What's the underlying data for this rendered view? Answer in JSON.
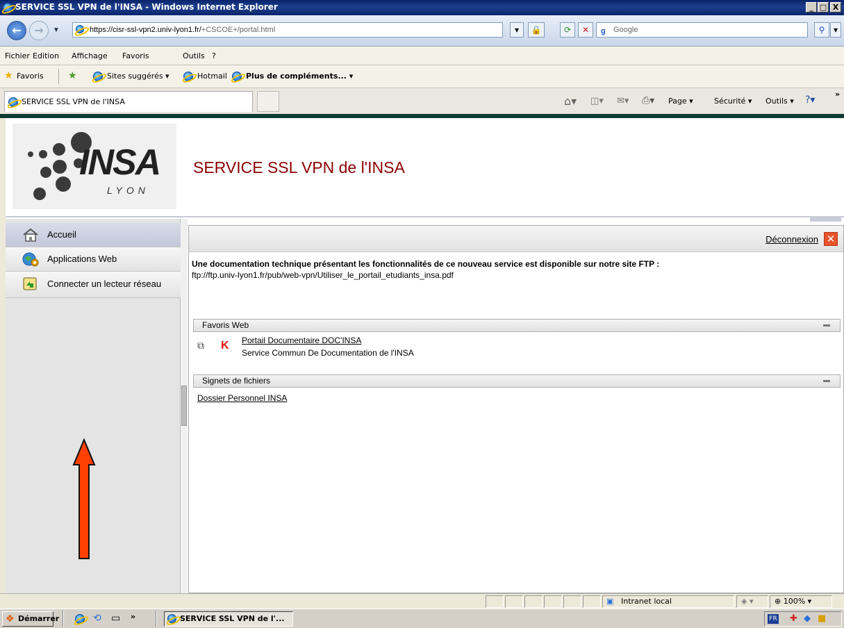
{
  "window": {
    "title": "SERVICE SSL VPN de l'INSA - Windows Internet Explorer",
    "min": "_",
    "max": "□",
    "close": "X"
  },
  "address": {
    "url_main": "https://cisr-ssl-vpn2.univ-lyon1.fr/",
    "url_rest": "+CSCOE+/portal.html",
    "search_placeholder": "Google"
  },
  "menu": [
    "Fichier",
    "Edition",
    "Affichage",
    "Favoris",
    "Outils",
    "?"
  ],
  "favorites_bar": {
    "favoris": "Favoris",
    "suggested": "Sites suggérés ▾",
    "hotmail": "Hotmail",
    "more": "Plus de compléments... ▾"
  },
  "tab": {
    "title": "SERVICE SSL VPN de l'INSA"
  },
  "command_bar": [
    "Page ▾",
    "Sécurité ▾",
    "Outils ▾"
  ],
  "header": {
    "logo_word": "INSA",
    "logo_city": "LYON",
    "title": "SERVICE SSL VPN de l'INSA"
  },
  "sidebar": {
    "items": [
      {
        "label": "Accueil",
        "icon": "home-icon"
      },
      {
        "label": "Applications Web",
        "icon": "globe-gear-icon"
      },
      {
        "label": "Connecter un lecteur réseau",
        "icon": "network-drive-icon"
      }
    ]
  },
  "content": {
    "logout": "Déconnexion",
    "intro": "Une documentation technique présentant les fonctionnalités de ce nouveau service est disponible sur notre site FTP :",
    "ftp_link": "ftp://ftp.univ-lyon1.fr/pub/web-vpn/Utiliser_le_portail_etudiants_insa.pdf",
    "web_bookmarks": {
      "title": "Favoris Web",
      "link": "Portail Documentaire DOC'INSA",
      "description": "Service Commun De Documentation de l'INSA"
    },
    "file_bookmarks": {
      "title": "Signets de fichiers",
      "link": "Dossier Personnel INSA"
    }
  },
  "statusbar": {
    "zone": "Intranet local",
    "zoom": "100%"
  },
  "taskbar": {
    "start": "Démarrer",
    "task": "SERVICE SSL VPN de l'...",
    "lang": "FR"
  },
  "colors": {
    "title_red": "#8b0000",
    "arrow": "#ff4000",
    "titlebar": "#0a246a"
  }
}
